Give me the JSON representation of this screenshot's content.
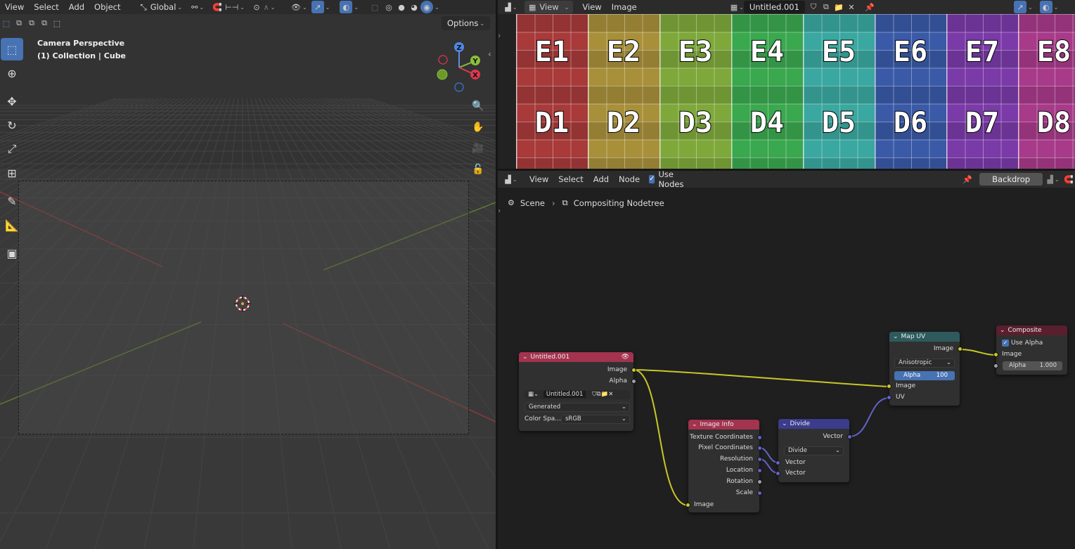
{
  "viewport": {
    "menu": [
      "View",
      "Select",
      "Add",
      "Object"
    ],
    "orientation": "Global",
    "options_label": "Options",
    "camera_label": "Camera Perspective",
    "collection_label": "(1) Collection | Cube",
    "gizmo_axes": {
      "z": "Z",
      "y": "Y",
      "x": "X"
    }
  },
  "image_editor": {
    "menu": [
      "View",
      "View",
      "Image"
    ],
    "image_name": "Untitled.001",
    "grid_rows": [
      [
        "E1",
        "E2",
        "E3",
        "E4",
        "E5",
        "E6",
        "E7",
        "E8"
      ],
      [
        "D1",
        "D2",
        "D3",
        "D4",
        "D5",
        "D6",
        "D7",
        "D8"
      ]
    ],
    "column_colors": [
      "#a83a3a",
      "#a8903a",
      "#7ea83a",
      "#3aa84e",
      "#3aa8a0",
      "#3a5aa8",
      "#7a3aa8",
      "#a83a8a"
    ]
  },
  "node_editor": {
    "menu": [
      "View",
      "Select",
      "Add",
      "Node"
    ],
    "use_nodes_label": "Use Nodes",
    "backdrop_label": "Backdrop",
    "breadcrumb": [
      "Scene",
      "Compositing Nodetree"
    ],
    "nodes": {
      "image": {
        "title": "Untitled.001",
        "out_image": "Image",
        "out_alpha": "Alpha",
        "image_name": "Untitled.001",
        "source": "Generated",
        "colorspace_label": "Color Spa...",
        "colorspace": "sRGB"
      },
      "image_info": {
        "title": "Image Info",
        "outputs": [
          "Texture Coordinates",
          "Pixel Coordinates",
          "Resolution",
          "Location",
          "Rotation",
          "Scale"
        ],
        "in_image": "Image"
      },
      "divide": {
        "title": "Divide",
        "out_vector": "Vector",
        "operation": "Divide",
        "inputs": [
          "Vector",
          "Vector"
        ]
      },
      "map_uv": {
        "title": "Map UV",
        "out_image": "Image",
        "filter": "Anisotropic",
        "alpha_label": "Alpha",
        "alpha_value": "100",
        "in_image": "Image",
        "in_uv": "UV"
      },
      "composite": {
        "title": "Composite",
        "use_alpha_label": "Use Alpha",
        "in_image": "Image",
        "alpha_label": "Alpha",
        "alpha_value": "1.000"
      }
    }
  }
}
